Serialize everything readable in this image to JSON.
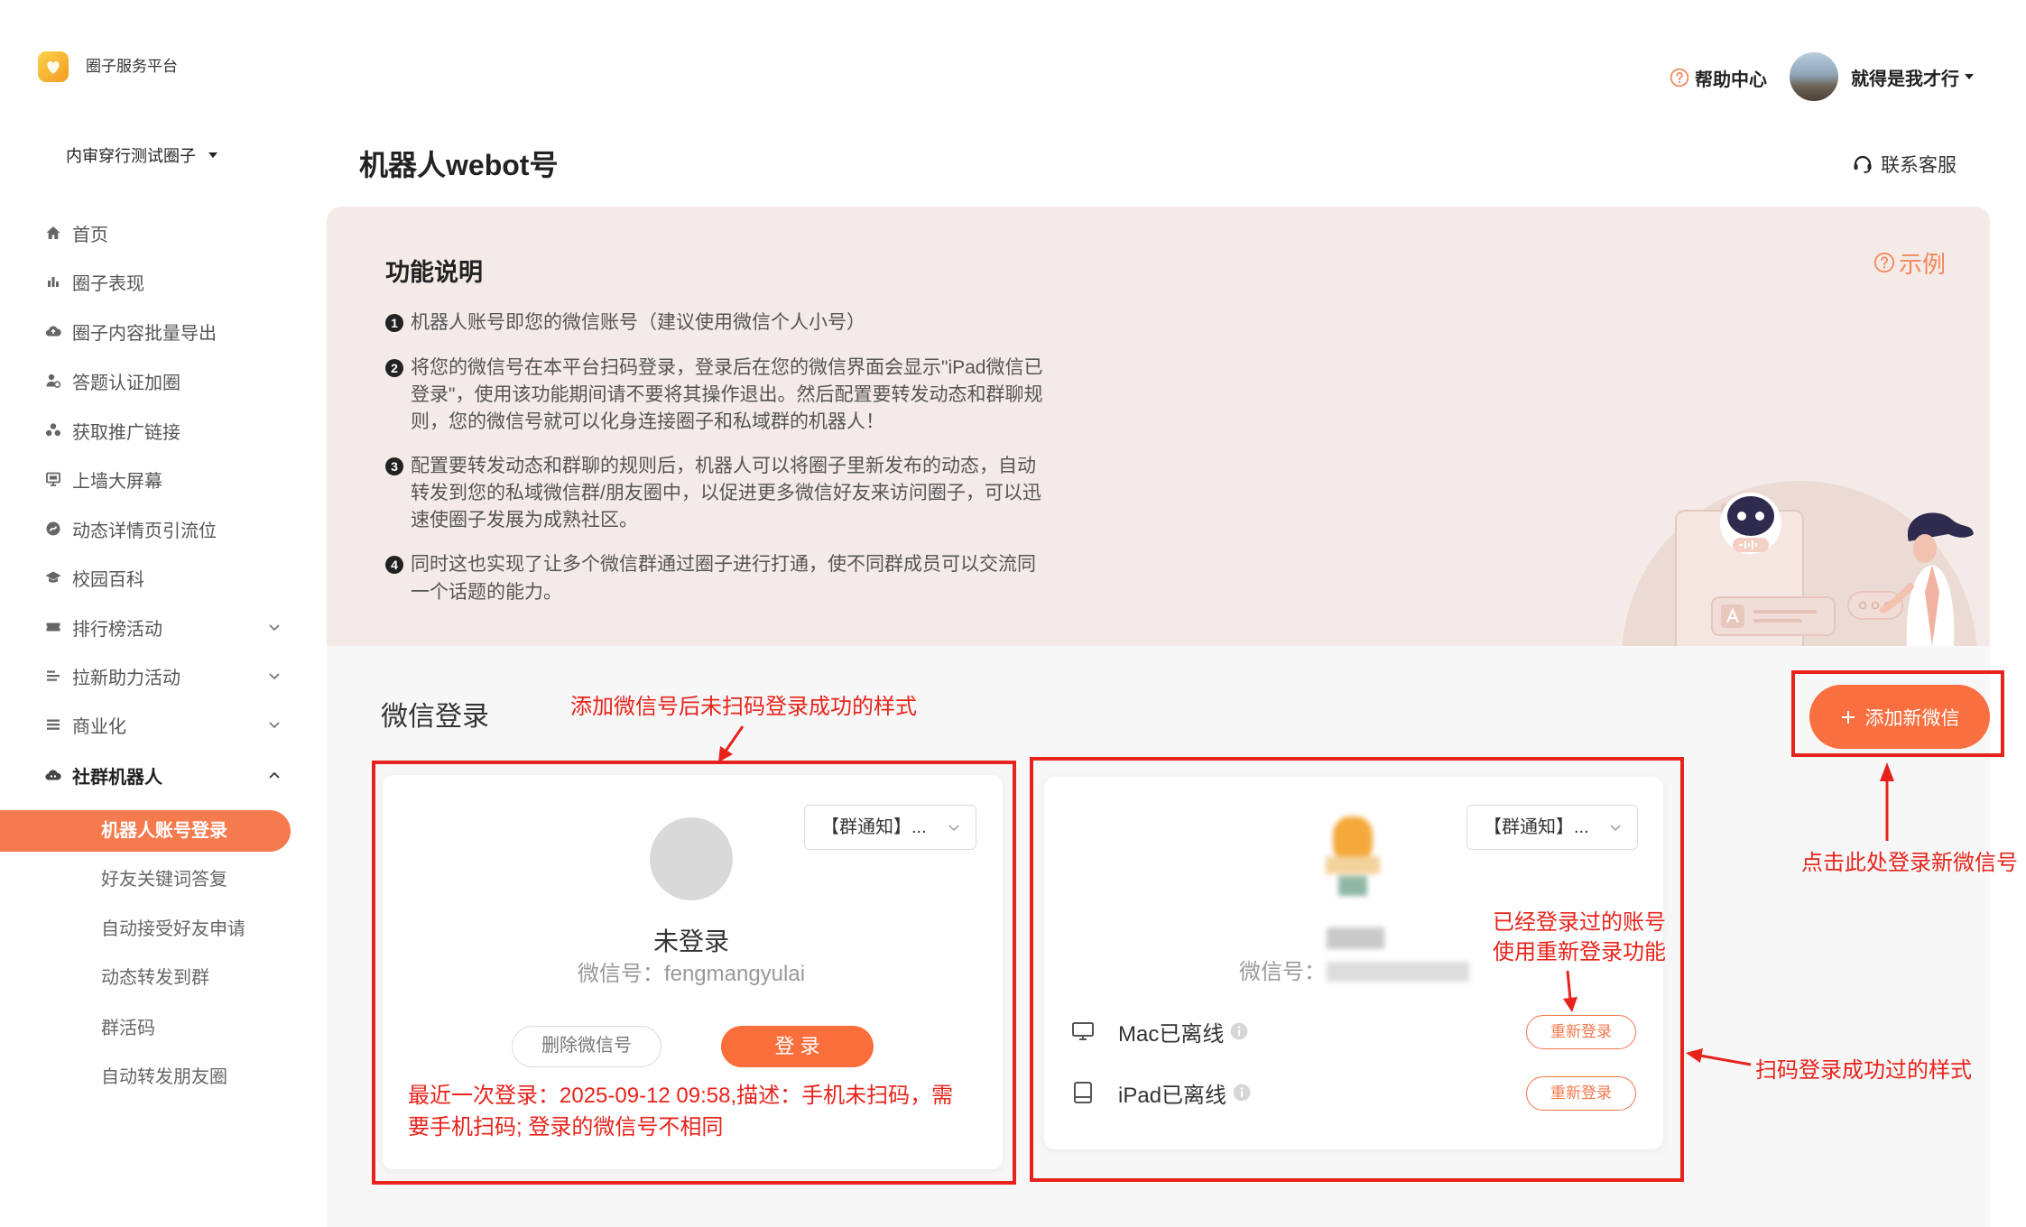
{
  "app": {
    "name": "圈子服务平台",
    "logo_icon": "circle-logo-icon"
  },
  "header": {
    "help_label": "帮助中心",
    "user_name": "就得是我才行",
    "contact_label": "联系客服"
  },
  "sidebar": {
    "circle_selector": "内审穿行测试圈子",
    "items": [
      {
        "label": "首页",
        "icon": "home-icon"
      },
      {
        "label": "圈子表现",
        "icon": "bar-chart-icon"
      },
      {
        "label": "圈子内容批量导出",
        "icon": "cloud-upload-icon"
      },
      {
        "label": "答题认证加圈",
        "icon": "user-check-icon"
      },
      {
        "label": "获取推广链接",
        "icon": "share-group-icon"
      },
      {
        "label": "上墙大屏幕",
        "icon": "monitor-icon"
      },
      {
        "label": "动态详情页引流位",
        "icon": "compass-icon"
      },
      {
        "label": "校园百科",
        "icon": "graduation-cap-icon"
      },
      {
        "label": "排行榜活动",
        "icon": "ticket-icon",
        "expandable": true
      },
      {
        "label": "拉新助力活动",
        "icon": "list-icon",
        "expandable": true
      },
      {
        "label": "商业化",
        "icon": "menu-icon",
        "expandable": true
      },
      {
        "label": "社群机器人",
        "icon": "robot-icon",
        "expanded": true
      }
    ],
    "sub_items": [
      "机器人账号登录",
      "好友关键词答复",
      "自动接受好友申请",
      "动态转发到群",
      "群活码",
      "自动转发朋友圈"
    ],
    "active_sub": "机器人账号登录"
  },
  "page": {
    "title": "机器人webot号"
  },
  "intro": {
    "heading": "功能说明",
    "example_label": "示例",
    "items": [
      {
        "num": "1",
        "lines": [
          "机器人账号即您的微信账号（建议使用微信个人小号）"
        ]
      },
      {
        "num": "2",
        "lines": [
          "将您的微信号在本平台扫码登录，登录后在您的微信界面会显示\"iPad微信已",
          "登录\"，使用该功能期间请不要将其操作退出。然后配置要转发动态和群聊规",
          "则，您的微信号就可以化身连接圈子和私域群的机器人！"
        ]
      },
      {
        "num": "3",
        "lines": [
          "配置要转发动态和群聊的规则后，机器人可以将圈子里新发布的动态，自动",
          "转发到您的私域微信群/朋友圈中，以促进更多微信好友来访问圈子，可以迅",
          "速使圈子发展为成熟社区。"
        ]
      },
      {
        "num": "4",
        "lines": [
          "同时这也实现了让多个微信群通过圈子进行打通，使不同群成员可以交流同",
          "一个话题的能力。"
        ]
      }
    ]
  },
  "login": {
    "section_title": "微信登录",
    "add_button_label": "添加新微信",
    "accounts": [
      {
        "group_select": "【群通知】...",
        "status": "未登录",
        "wechat_id_label": "微信号：",
        "wechat_id": "fengmangyulai",
        "delete_label": "删除微信号",
        "login_label": "登 录",
        "last_login_lines": [
          "最近一次登录：2025-09-12 09:58,描述：手机未扫码，需",
          "要手机扫码; 登录的微信号不相同"
        ]
      },
      {
        "group_select": "【群通知】...",
        "wechat_id_label": "微信号：",
        "devices": [
          {
            "name": "Mac已离线",
            "icon": "monitor-icon",
            "action": "重新登录"
          },
          {
            "name": "iPad已离线",
            "icon": "tablet-icon",
            "action": "重新登录"
          }
        ]
      }
    ]
  },
  "annotations": {
    "unscanned_style": "添加微信号后未扫码登录成功的样式",
    "relogin_hint": [
      "已经登录过的账号",
      "使用重新登录功能"
    ],
    "add_hint": "点击此处登录新微信号",
    "scanned_style": "扫码登录成功过的样式"
  },
  "colors": {
    "accent": "#f96f3f",
    "active_nav": "#f57a4d",
    "annotation": "#e8231b",
    "intro_bg": "#f4ebe8",
    "lower_bg": "#f7f7f7"
  }
}
